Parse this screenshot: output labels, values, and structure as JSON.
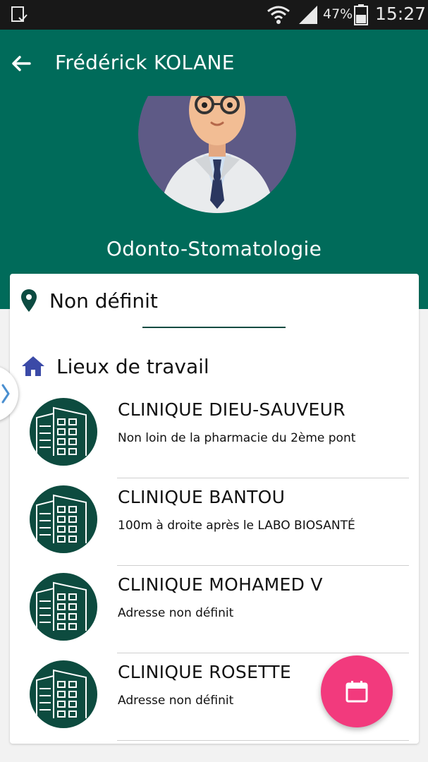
{
  "status_bar": {
    "battery_percent": "47%",
    "time": "15:27",
    "icons": [
      "notification-icon",
      "wifi-icon",
      "signal-icon",
      "battery-icon"
    ]
  },
  "header": {
    "title": "Frédérick KOLANE",
    "specialty": "Odonto-Stomatologie",
    "colors": {
      "primary": "#006b5a",
      "fab": "#f23a7d"
    }
  },
  "location": {
    "label": "Non définit"
  },
  "workplaces": {
    "title": "Lieux de travail",
    "items": [
      {
        "name": "CLINIQUE DIEU-SAUVEUR",
        "address": "Non loin de la pharmacie du 2ème pont"
      },
      {
        "name": "CLINIQUE BANTOU",
        "address": "100m à droite après le LABO BIOSANTÉ"
      },
      {
        "name": "CLINIQUE MOHAMED V",
        "address": "Adresse non définit"
      },
      {
        "name": "CLINIQUE ROSETTE",
        "address": "Adresse non définit"
      }
    ]
  }
}
